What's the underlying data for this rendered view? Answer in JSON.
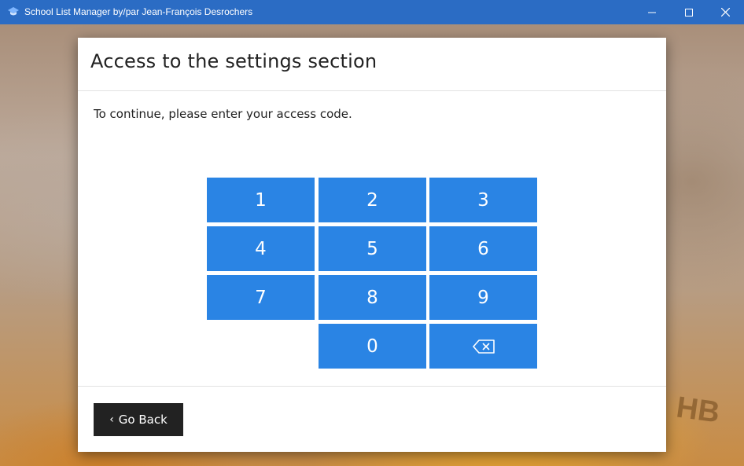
{
  "window": {
    "title": "School List Manager by/par Jean-François Desrochers",
    "icon": "graduation-cap-icon",
    "controls": [
      "minimize-icon",
      "maximize-icon",
      "close-icon"
    ]
  },
  "dialog": {
    "title": "Access to the settings section",
    "instruction": "To continue, please enter your access code.",
    "keypad": {
      "keys": [
        "1",
        "2",
        "3",
        "4",
        "5",
        "6",
        "7",
        "8",
        "9",
        "0"
      ],
      "backspace_icon": "backspace-icon",
      "key_color": "#2a84e4"
    },
    "back_button": {
      "label": "Go Back",
      "icon": "chevron-left-icon"
    }
  },
  "colors": {
    "titlebar": "#2b6cc4",
    "back_button": "#222222"
  }
}
